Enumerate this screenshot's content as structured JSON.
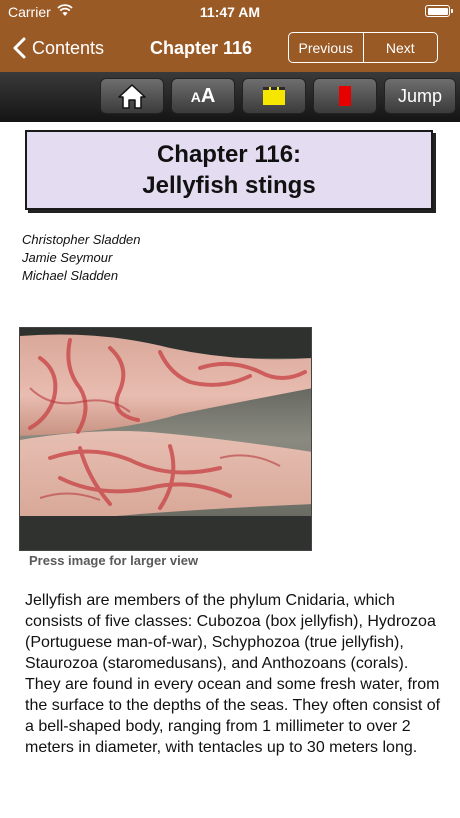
{
  "status": {
    "carrier": "Carrier",
    "time": "11:47 AM"
  },
  "nav": {
    "back_label": "Contents",
    "title": "Chapter 116",
    "previous": "Previous",
    "next": "Next"
  },
  "toolbar": {
    "home_icon": "home-icon",
    "font_icon": "font-size-icon",
    "note_icon": "yellow-note-icon",
    "bookmark_icon": "red-bookmark-icon",
    "jump": "Jump"
  },
  "colors": {
    "nav_bg": "#9a5a26",
    "title_box_bg": "#e4dcf0",
    "note": "#f6e600",
    "bookmark": "#e60000"
  },
  "chapter": {
    "line1": "Chapter 116:",
    "line2": "Jellyfish stings"
  },
  "authors": [
    "Christopher Sladden",
    "Jamie Seymour",
    "Michael Sladden"
  ],
  "image_caption": "Press image for larger view",
  "body": "Jellyfish are members of the phylum Cnidaria, which consists of five classes: Cubozoa (box jellyfish), Hydrozoa (Portuguese man-of-war), Schyphozoa (true jellyfish), Staurozoa (staromedusans), and Anthozoans (corals). They are found in every ocean and some fresh water, from the surface to the depths of the seas. They often consist of a bell-shaped body, ranging from 1 millimeter to over 2 meters in diameter, with tentacles up to 30 meters long."
}
